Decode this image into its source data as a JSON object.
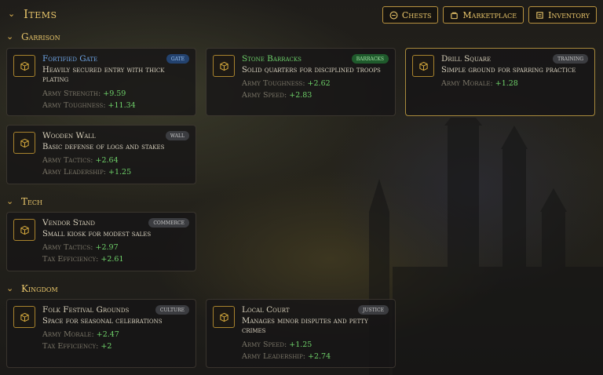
{
  "header": {
    "title": "Items"
  },
  "top_buttons": [
    {
      "label": "Chests",
      "icon": "coin-icon"
    },
    {
      "label": "Marketplace",
      "icon": "bag-icon"
    },
    {
      "label": "Inventory",
      "icon": "scroll-icon"
    }
  ],
  "sections": {
    "garrison": {
      "title": "Garrison"
    },
    "tech": {
      "title": "Tech"
    },
    "kingdom": {
      "title": "Kingdom"
    }
  },
  "cards": {
    "fortified_gate": {
      "name": "Fortified Gate",
      "badge": "gate",
      "desc": "Heavily secured entry with thick plating",
      "stats": [
        {
          "label": "Army Strength:",
          "value": "+9.59"
        },
        {
          "label": "Army Toughness:",
          "value": "+11.34"
        }
      ]
    },
    "stone_barracks": {
      "name": "Stone Barracks",
      "badge": "barracks",
      "desc": "Solid quarters for disciplined troops",
      "stats": [
        {
          "label": "Army Toughness:",
          "value": "+2.62"
        },
        {
          "label": "Army Speed:",
          "value": "+2.83"
        }
      ]
    },
    "drill_square": {
      "name": "Drill Square",
      "badge": "training",
      "desc": "Simple ground for sparring practice",
      "stats": [
        {
          "label": "Army Morale:",
          "value": "+1.28"
        }
      ]
    },
    "wooden_wall": {
      "name": "Wooden Wall",
      "badge": "wall",
      "desc": "Basic defense of logs and stakes",
      "stats": [
        {
          "label": "Army Tactics:",
          "value": "+2.64"
        },
        {
          "label": "Army Leadership:",
          "value": "+1.25"
        }
      ]
    },
    "vendor_stand": {
      "name": "Vendor Stand",
      "badge": "commerce",
      "desc": "Small kiosk for modest sales",
      "stats": [
        {
          "label": "Army Tactics:",
          "value": "+2.97"
        },
        {
          "label": "Tax Efficiency:",
          "value": "+2.61"
        }
      ]
    },
    "folk_festival": {
      "name": "Folk Festival Grounds",
      "badge": "culture",
      "desc": "Space for seasonal celebrations",
      "stats": [
        {
          "label": "Army Morale:",
          "value": "+2.47"
        },
        {
          "label": "Tax Efficiency:",
          "value": "+2"
        }
      ]
    },
    "local_court": {
      "name": "Local Court",
      "badge": "justice",
      "desc": "Manages minor disputes and petty crimes",
      "stats": [
        {
          "label": "Army Speed:",
          "value": "+1.25"
        },
        {
          "label": "Army Leadership:",
          "value": "+2.74"
        }
      ]
    }
  },
  "colors": {
    "accent": "#e8c56a",
    "positive": "#6fd36a",
    "gate_name": "#6fa6e8",
    "barracks_name": "#6ccf6a"
  }
}
